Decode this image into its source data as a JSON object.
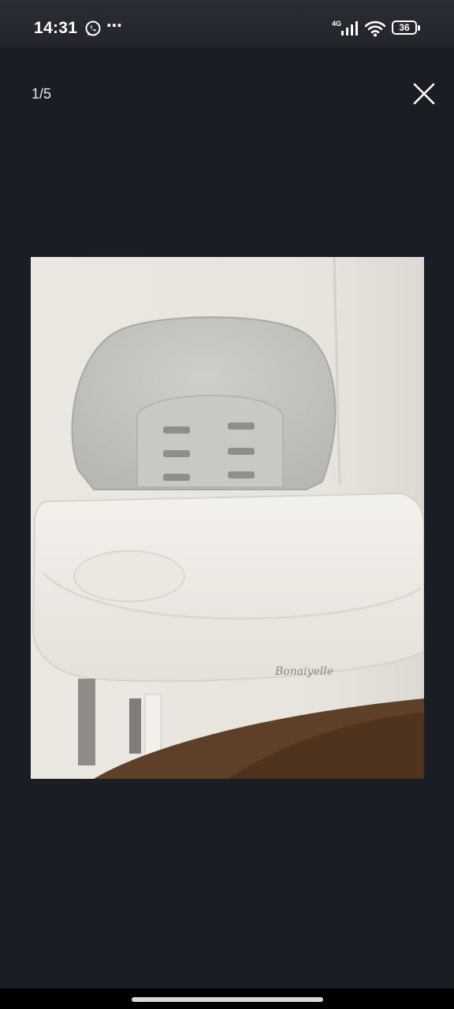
{
  "status_bar": {
    "time": "14:31",
    "network": "4G",
    "battery": "36",
    "icons": [
      "whatsapp-icon",
      "more-dots-icon",
      "signal-icon",
      "wifi-icon",
      "battery-icon"
    ]
  },
  "viewer": {
    "counter": "1/5",
    "close_icon": "close-icon",
    "photo": {
      "subject": "high-chair-photo",
      "brand_mark": "Bonaiyelle"
    }
  },
  "colors": {
    "background": "#1a1d24",
    "status_bar": "#2a2d33",
    "foreground": "#ffffff"
  }
}
